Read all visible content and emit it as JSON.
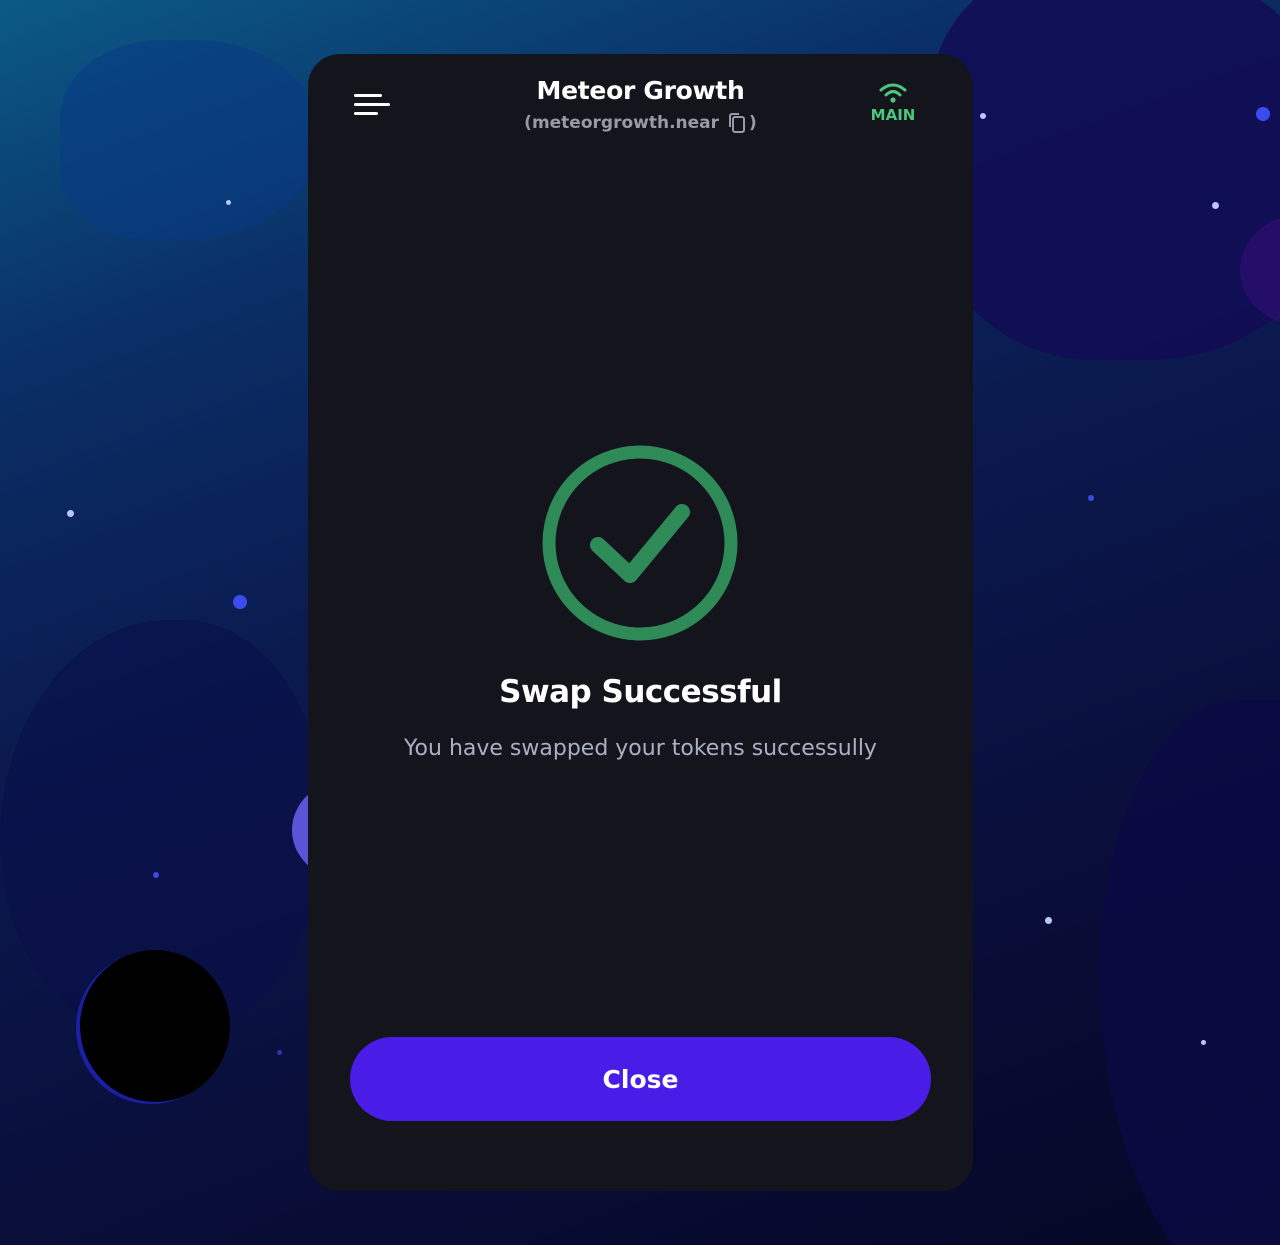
{
  "header": {
    "menu_icon": "hamburger-menu-icon",
    "wallet_name": "Meteor Growth",
    "account_id": "(meteorgrowth.near",
    "account_close_paren": ")",
    "copy_icon": "copy-icon",
    "network_icon": "wifi-icon",
    "network_label": "MAIN"
  },
  "result": {
    "icon": "checkmark-circle-icon",
    "title": "Swap Successful",
    "message": "You have swapped your tokens successully"
  },
  "actions": {
    "close_label": "Close"
  },
  "colors": {
    "card_background": "#14141c",
    "success_green": "#2e8a57",
    "network_green": "#4cc67a",
    "primary_button": "#4a1ce8"
  }
}
